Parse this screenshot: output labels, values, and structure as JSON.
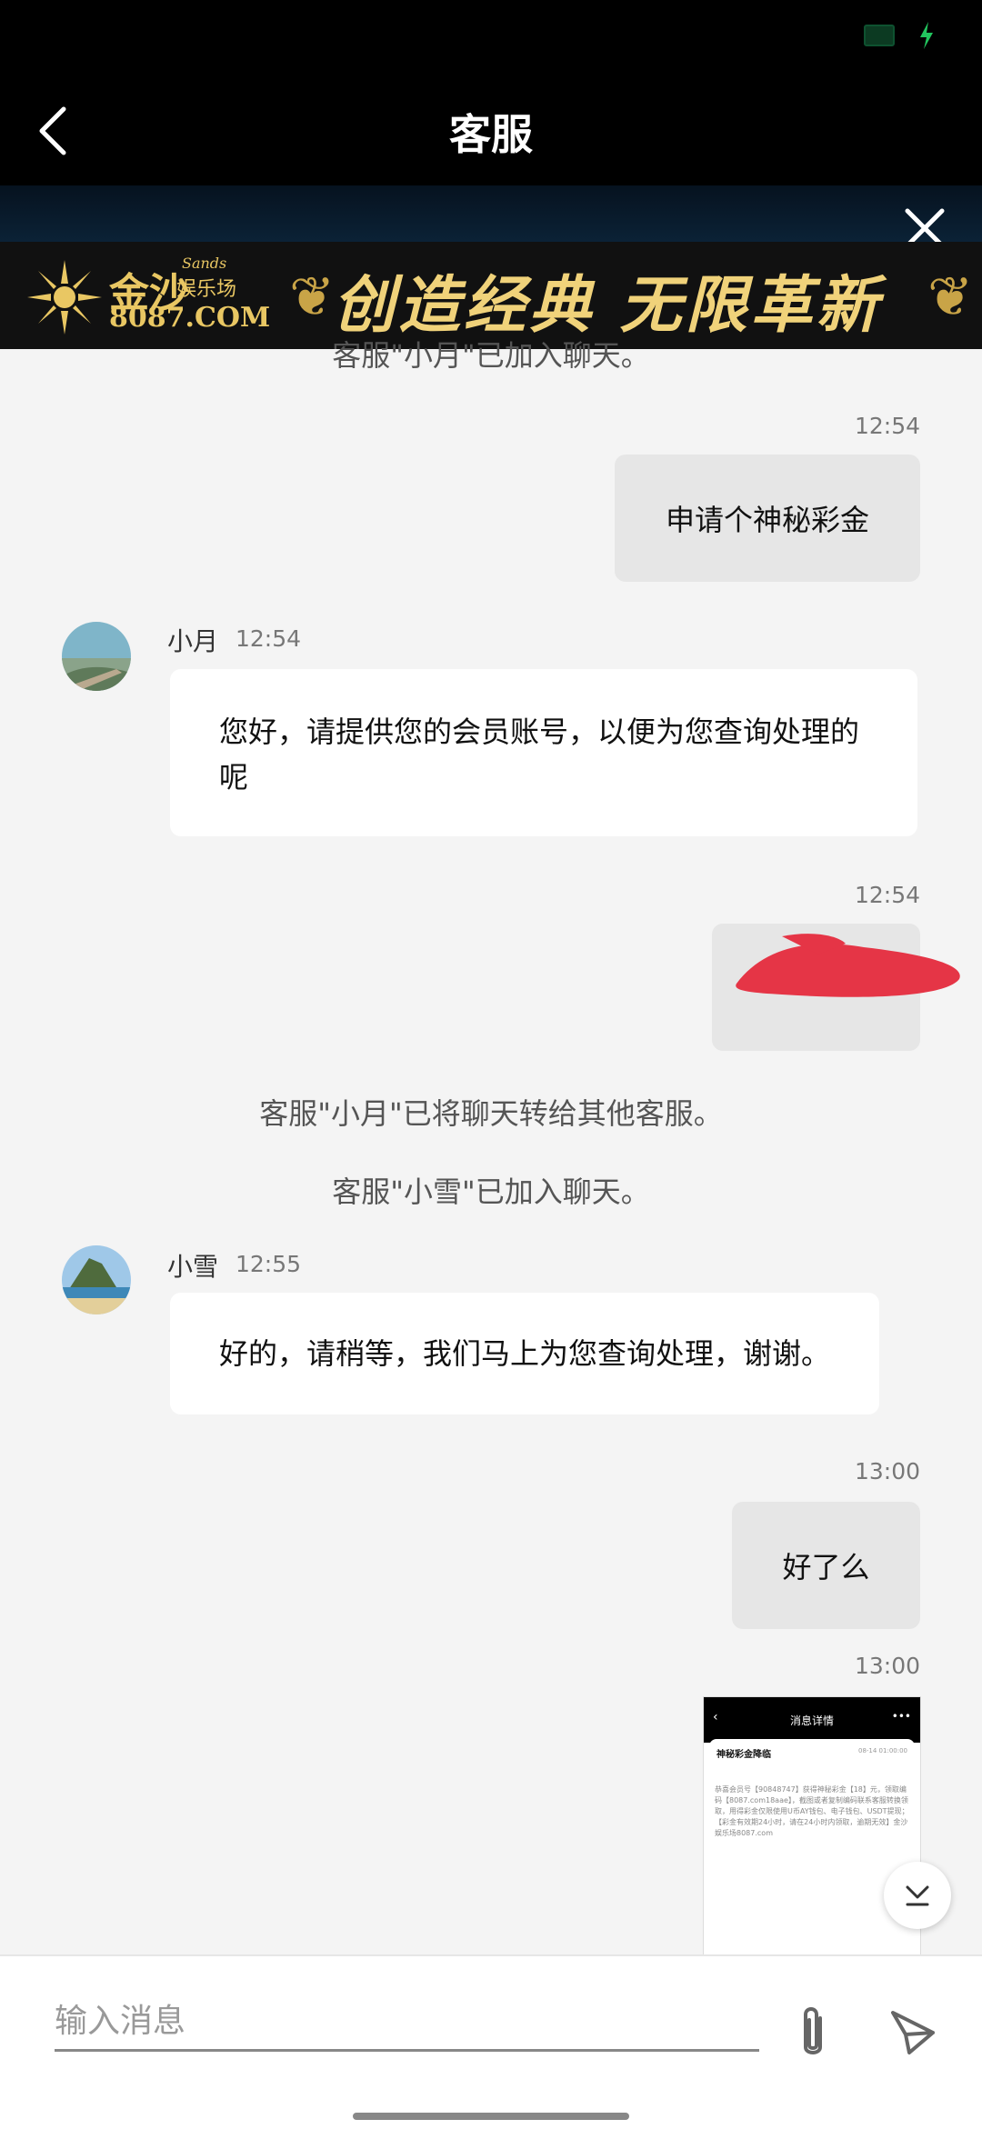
{
  "header": {
    "title": "客服",
    "back_icon": "chevron-left-icon"
  },
  "banner": {
    "brand": "金沙",
    "sub": "娱乐场",
    "sands": "Sands",
    "url": "8087.COM",
    "slogan": "创造经典 无限革新",
    "close_icon": "close-icon"
  },
  "messages": {
    "sys_joined_xiaoyue": "客服\"小月\"已加入聊天。",
    "out1": {
      "time": "12:54",
      "text": "申请个神秘彩金"
    },
    "in1": {
      "name": "小月",
      "time": "12:54",
      "text": "您好，请提供您的会员账号，以便为您查询处理的呢"
    },
    "out2": {
      "time": "12:54",
      "text": ""
    },
    "sys_transfer": "客服\"小月\"已将聊天转给其他客服。",
    "sys_joined_xiaoxue": "客服\"小雪\"已加入聊天。",
    "in2": {
      "name": "小雪",
      "time": "12:55",
      "text": "好的，请稍等，我们马上为您查询处理，谢谢。"
    },
    "out3": {
      "time": "13:00",
      "text": "好了么"
    },
    "out4": {
      "time": "13:00",
      "thumb_title": "消息详情",
      "thumb_card": "神秘彩金降临",
      "thumb_date": "08-14 01:00:00",
      "thumb_body": "恭喜会员号【90848747】获得神秘彩金【18】元，领取编码【8087.com18aae】，截图或者复制编码联系客服转换领取，用得彩金仅限使用U币AY钱包、电子钱包、USDT提现；【彩金有效期24小时，请在24小时内领取，逾期无效】金沙娱乐场8087.com"
    }
  },
  "input": {
    "placeholder": "输入消息"
  },
  "colors": {
    "accent_gold": "#e9c763",
    "bubble_out": "#e6e6e6",
    "bubble_in": "#ffffff",
    "charging_green": "#22c55e"
  }
}
